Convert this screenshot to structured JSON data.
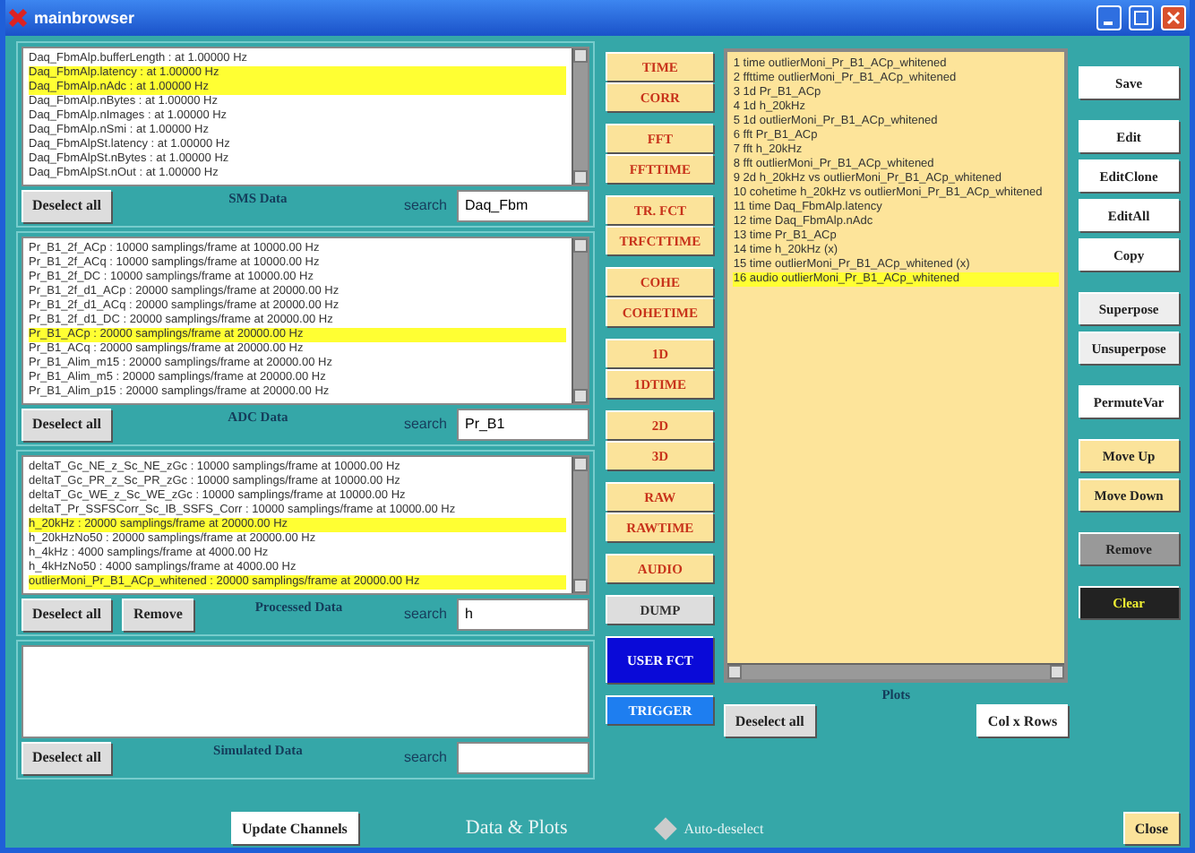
{
  "window": {
    "title": "mainbrowser"
  },
  "panels": [
    {
      "title": "SMS Data",
      "search_label": "search",
      "search_value": "Daq_Fbm",
      "buttons": [
        "Deselect all"
      ],
      "items": [
        {
          "text": "Daq_FbmAlp.bufferLength : at 1.00000 Hz",
          "selected": false
        },
        {
          "text": "Daq_FbmAlp.latency : at 1.00000 Hz",
          "selected": true
        },
        {
          "text": "Daq_FbmAlp.nAdc : at 1.00000 Hz",
          "selected": true
        },
        {
          "text": "Daq_FbmAlp.nBytes : at 1.00000 Hz",
          "selected": false
        },
        {
          "text": "Daq_FbmAlp.nImages : at 1.00000 Hz",
          "selected": false
        },
        {
          "text": "Daq_FbmAlp.nSmi : at 1.00000 Hz",
          "selected": false
        },
        {
          "text": "Daq_FbmAlpSt.latency : at 1.00000 Hz",
          "selected": false
        },
        {
          "text": "Daq_FbmAlpSt.nBytes : at 1.00000 Hz",
          "selected": false
        },
        {
          "text": "Daq_FbmAlpSt.nOut : at 1.00000 Hz",
          "selected": false
        }
      ]
    },
    {
      "title": "ADC Data",
      "search_label": "search",
      "search_value": "Pr_B1",
      "buttons": [
        "Deselect all"
      ],
      "items": [
        {
          "text": "Pr_B1_2f_ACp : 10000 samplings/frame at 10000.00 Hz",
          "selected": false
        },
        {
          "text": "Pr_B1_2f_ACq : 10000 samplings/frame at 10000.00 Hz",
          "selected": false
        },
        {
          "text": "Pr_B1_2f_DC : 10000 samplings/frame at 10000.00 Hz",
          "selected": false
        },
        {
          "text": "Pr_B1_2f_d1_ACp : 20000 samplings/frame at 20000.00 Hz",
          "selected": false
        },
        {
          "text": "Pr_B1_2f_d1_ACq : 20000 samplings/frame at 20000.00 Hz",
          "selected": false
        },
        {
          "text": "Pr_B1_2f_d1_DC : 20000 samplings/frame at 20000.00 Hz",
          "selected": false
        },
        {
          "text": "Pr_B1_ACp : 20000 samplings/frame at 20000.00 Hz",
          "selected": true
        },
        {
          "text": "Pr_B1_ACq : 20000 samplings/frame at 20000.00 Hz",
          "selected": false
        },
        {
          "text": "Pr_B1_Alim_m15 : 20000 samplings/frame at 20000.00 Hz",
          "selected": false
        },
        {
          "text": "Pr_B1_Alim_m5 : 20000 samplings/frame at 20000.00 Hz",
          "selected": false
        },
        {
          "text": "Pr_B1_Alim_p15 : 20000 samplings/frame at 20000.00 Hz",
          "selected": false
        }
      ]
    },
    {
      "title": "Processed Data",
      "search_label": "search",
      "search_value": "h",
      "buttons": [
        "Deselect all",
        "Remove"
      ],
      "items": [
        {
          "text": "deltaT_Gc_NE_z_Sc_NE_zGc : 10000 samplings/frame at 10000.00 Hz",
          "selected": false
        },
        {
          "text": "deltaT_Gc_PR_z_Sc_PR_zGc : 10000 samplings/frame at 10000.00 Hz",
          "selected": false
        },
        {
          "text": "deltaT_Gc_WE_z_Sc_WE_zGc : 10000 samplings/frame at 10000.00 Hz",
          "selected": false
        },
        {
          "text": "deltaT_Pr_SSFSCorr_Sc_IB_SSFS_Corr : 10000 samplings/frame at 10000.00 Hz",
          "selected": false
        },
        {
          "text": "h_20kHz : 20000 samplings/frame at 20000.00 Hz",
          "selected": true
        },
        {
          "text": "h_20kHzNo50 : 20000 samplings/frame at 20000.00 Hz",
          "selected": false
        },
        {
          "text": "h_4kHz : 4000 samplings/frame at 4000.00 Hz",
          "selected": false
        },
        {
          "text": "h_4kHzNo50 : 4000 samplings/frame at 4000.00 Hz",
          "selected": false
        },
        {
          "text": "outlierMoni_Pr_B1_ACp_whitened : 20000 samplings/frame at 20000.00 Hz",
          "selected": true
        }
      ]
    },
    {
      "title": "Simulated Data",
      "search_label": "search",
      "buttons": [
        "Deselect all"
      ]
    }
  ],
  "update_button": "Update Channels",
  "function_groups": [
    [
      {
        "label": "TIME",
        "kind": "plot"
      },
      {
        "label": "CORR",
        "kind": "plot"
      }
    ],
    [
      {
        "label": "FFT",
        "kind": "plot"
      },
      {
        "label": "FFTTIME",
        "kind": "plot"
      }
    ],
    [
      {
        "label": "TR. FCT",
        "kind": "plot"
      },
      {
        "label": "TRFCTTIME",
        "kind": "plot"
      }
    ],
    [
      {
        "label": "COHE",
        "kind": "plot"
      },
      {
        "label": "COHETIME",
        "kind": "plot"
      }
    ],
    [
      {
        "label": "1D",
        "kind": "plot"
      },
      {
        "label": "1DTIME",
        "kind": "plot"
      }
    ],
    [
      {
        "label": "2D",
        "kind": "plot"
      },
      {
        "label": "3D",
        "kind": "plot"
      }
    ],
    [
      {
        "label": "RAW",
        "kind": "plot"
      },
      {
        "label": "RAWTIME",
        "kind": "plot"
      }
    ],
    [
      {
        "label": "AUDIO",
        "kind": "plot"
      }
    ],
    [
      {
        "label": "DUMP",
        "kind": "dump"
      }
    ],
    [
      {
        "label": "USER FCT",
        "kind": "user"
      }
    ],
    [
      {
        "label": "TRIGGER",
        "kind": "trigger"
      }
    ]
  ],
  "section_label": "Data & Plots",
  "plots": {
    "title": "Plots",
    "buttons": [
      "Deselect all",
      "Col x Rows"
    ],
    "items": [
      {
        "text": "1 time outlierMoni_Pr_B1_ACp_whitened",
        "selected": false
      },
      {
        "text": "2 ffttime outlierMoni_Pr_B1_ACp_whitened",
        "selected": false
      },
      {
        "text": "3 1d Pr_B1_ACp",
        "selected": false
      },
      {
        "text": "4 1d h_20kHz",
        "selected": false
      },
      {
        "text": "5 1d outlierMoni_Pr_B1_ACp_whitened",
        "selected": false
      },
      {
        "text": "6 fft Pr_B1_ACp",
        "selected": false
      },
      {
        "text": "7 fft h_20kHz",
        "selected": false
      },
      {
        "text": "8 fft outlierMoni_Pr_B1_ACp_whitened",
        "selected": false
      },
      {
        "text": "9 2d h_20kHz vs outlierMoni_Pr_B1_ACp_whitened",
        "selected": false
      },
      {
        "text": "10 cohetime h_20kHz vs outlierMoni_Pr_B1_ACp_whitened",
        "selected": false
      },
      {
        "text": "11 time Daq_FbmAlp.latency",
        "selected": false
      },
      {
        "text": "12 time Daq_FbmAlp.nAdc",
        "selected": false
      },
      {
        "text": "13 time Pr_B1_ACp",
        "selected": false
      },
      {
        "text": "14 time h_20kHz (x)",
        "selected": false
      },
      {
        "text": "15 time outlierMoni_Pr_B1_ACp_whitened (x)",
        "selected": false
      },
      {
        "text": "16 audio outlierMoni_Pr_B1_ACp_whitened",
        "selected": true
      }
    ]
  },
  "plot_button_groups": [
    [
      {
        "label": "Save",
        "kind": "white"
      }
    ],
    [
      {
        "label": "Edit",
        "kind": "white"
      },
      {
        "label": "EditClone",
        "kind": "white"
      },
      {
        "label": "EditAll",
        "kind": "white"
      },
      {
        "label": "Copy",
        "kind": "white"
      }
    ],
    [
      {
        "label": "Superpose",
        "kind": "light"
      },
      {
        "label": "Unsuperpose",
        "kind": "light"
      }
    ],
    [
      {
        "label": "PermuteVar",
        "kind": "white"
      }
    ],
    [
      {
        "label": "Move Up",
        "kind": "yellow"
      },
      {
        "label": "Move Down",
        "kind": "yellow"
      }
    ],
    [
      {
        "label": "Remove",
        "kind": "grey"
      }
    ],
    [
      {
        "label": "Clear",
        "kind": "dark"
      }
    ]
  ],
  "auto_deselect": {
    "label": "Auto-deselect",
    "checked": false
  },
  "close_button": "Close"
}
